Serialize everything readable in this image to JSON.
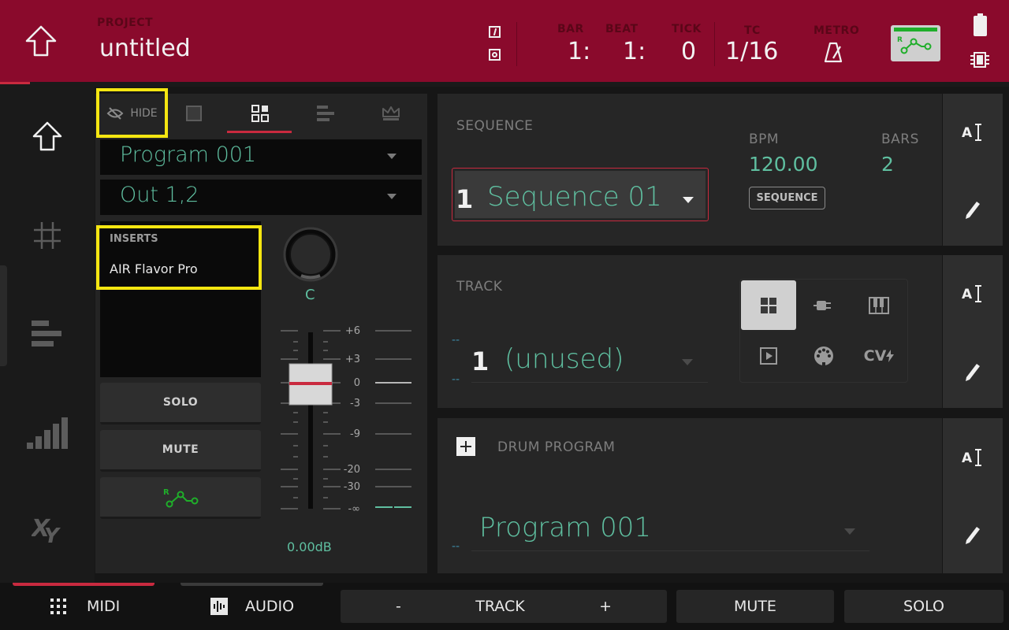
{
  "header": {
    "project_label": "PROJECT",
    "project_name": "untitled",
    "counter_labels": {
      "bar": "BAR",
      "beat": "BEAT",
      "tick": "TICK",
      "tc": "TC",
      "metro": "METRO"
    },
    "bar_value": "1:",
    "beat_value": "1:",
    "tick_value": "0",
    "tc_value": "1/16",
    "accent_color": "#8a0a2c"
  },
  "left_nav": {
    "items": [
      {
        "name": "home",
        "icon": "home-icon"
      },
      {
        "name": "grid",
        "icon": "grid-icon"
      },
      {
        "name": "track-view",
        "icon": "bars-icon"
      },
      {
        "name": "mixer",
        "icon": "level-icon"
      },
      {
        "name": "xy",
        "icon": "xy-icon"
      }
    ]
  },
  "channel": {
    "tabs": [
      {
        "label": "HIDE",
        "icon": "eye-slash-icon"
      },
      {
        "icon": "square-icon"
      },
      {
        "icon": "pads-grid-icon",
        "active": true
      },
      {
        "icon": "bars-icon"
      },
      {
        "icon": "crown-icon"
      }
    ],
    "program_select": "Program 001",
    "output_select": "Out 1,2",
    "inserts_label": "INSERTS",
    "insert_slot_1": "AIR Flavor Pro",
    "pan_value": "C",
    "solo_label": "SOLO",
    "mute_label": "MUTE",
    "volume_db": "0.00dB",
    "fader_scale": [
      "+6",
      "+3",
      "0",
      "-3",
      "-9",
      "-20",
      "-30",
      "-∞"
    ]
  },
  "sequence": {
    "label": "SEQUENCE",
    "number": "1",
    "name": "Sequence 01",
    "bpm_label": "BPM",
    "bpm_value": "120.00",
    "bars_label": "BARS",
    "bars_value": "2",
    "bpm_source_button": "SEQUENCE"
  },
  "track": {
    "label": "TRACK",
    "number": "1",
    "name": "(unused)",
    "placeholder_dash": "--",
    "type_labels": {
      "cv": "CV"
    }
  },
  "program": {
    "type_label": "DRUM PROGRAM",
    "name": "Program 001",
    "placeholder_dash": "--"
  },
  "bottom_bar": {
    "midi_label": "MIDI",
    "audio_label": "AUDIO",
    "track_minus": "-",
    "track_label": "TRACK",
    "track_plus": "+",
    "mute_label": "MUTE",
    "solo_label": "SOLO"
  }
}
